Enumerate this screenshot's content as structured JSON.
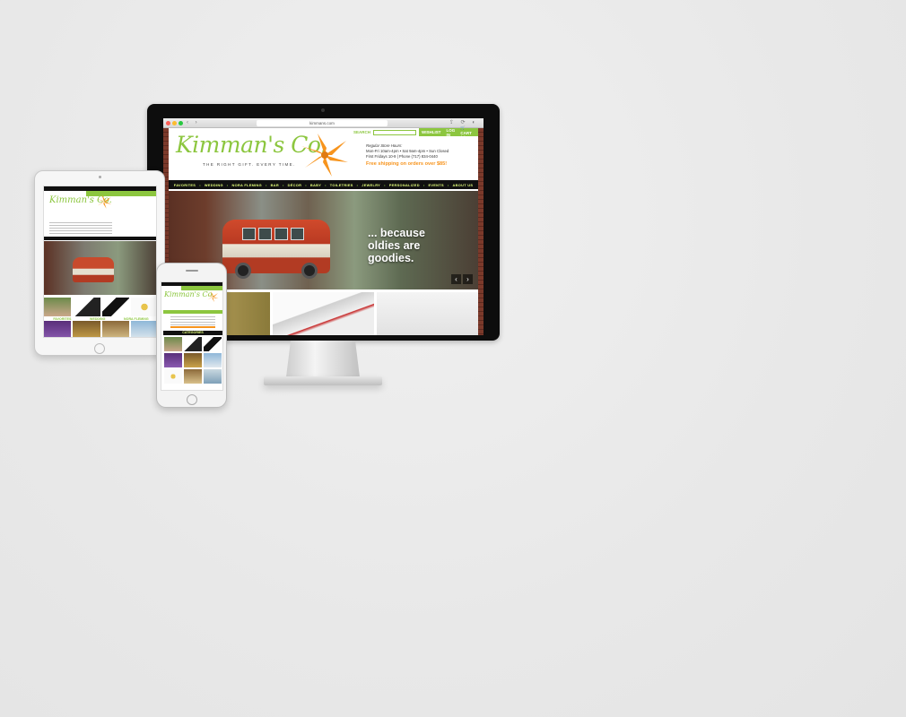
{
  "browser": {
    "url": "kimmans.com",
    "nav_glyphs": "‹ ›",
    "right_glyphs": "⇪ ⟳ ◐"
  },
  "site": {
    "logo": "Kimman's Co.",
    "tagline": "THE RIGHT GIFT. EVERY TIME.",
    "topbar": {
      "search_label": "SEARCH",
      "wishlist": "WISHLIST",
      "login": "LOG IN",
      "cart": "🛒 CART (0)"
    },
    "hours": {
      "title": "Regular Store Hours:",
      "line1": "Mon-Fri 10am-4pm • Sat 9am-4pm • Sun Closed",
      "line2": "First Fridays 10-9 | Phone (717) 834-0440"
    },
    "free_shipping": "Free shipping on orders over $85!",
    "nav": [
      "FAVORITES",
      "WEDDING",
      "NORA FLEMING",
      "BAR",
      "DÉCOR",
      "BABY",
      "TOILETRIES",
      "JEWELRY",
      "PERSONALIZED",
      "EVENTS",
      "ABOUT US"
    ],
    "nav_sep": "•",
    "hero": {
      "line1": "... because",
      "line2": "oldies are",
      "line3": "goodies."
    },
    "prev": "‹",
    "next": "›"
  },
  "tablet": {
    "logo": "Kimman's Co.",
    "labels": [
      "FAVORITES",
      "WEDDING",
      "NORA FLEMING"
    ]
  },
  "phone": {
    "logo": "Kimman's Co.",
    "categories": "CATEGORIES"
  },
  "colors": {
    "brand_green": "#8cc63f",
    "brand_orange": "#f7941d"
  }
}
